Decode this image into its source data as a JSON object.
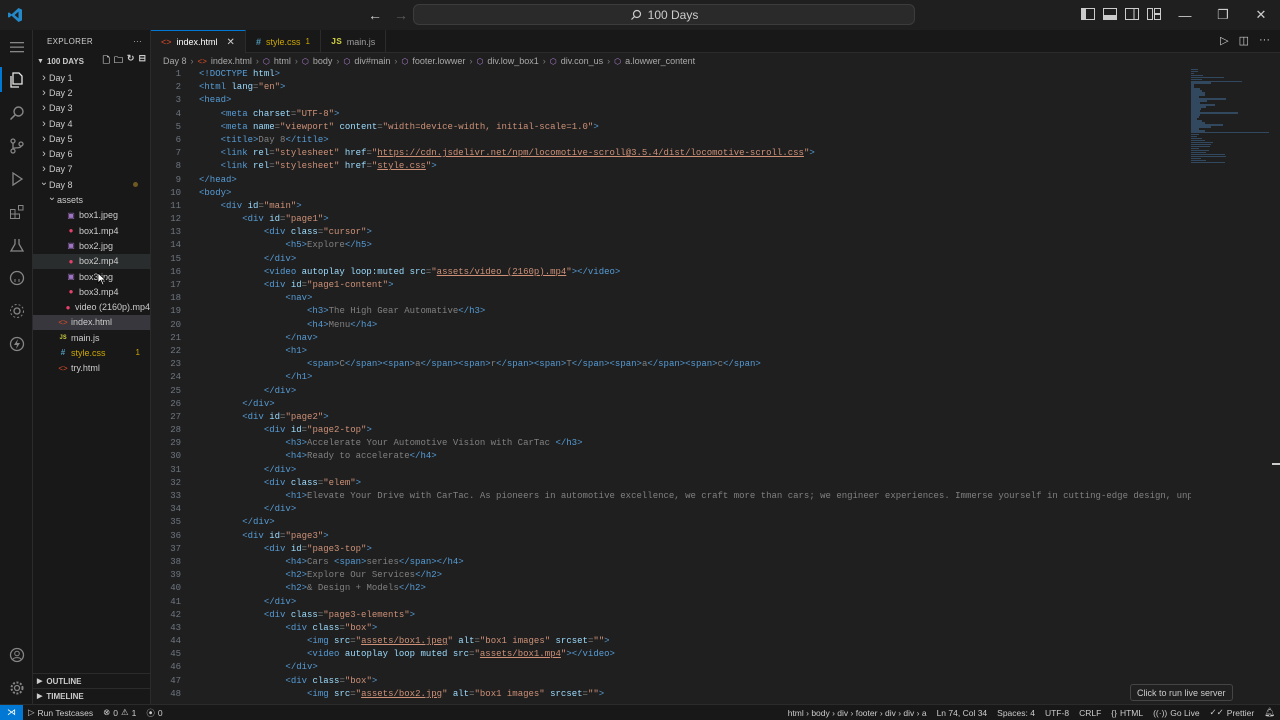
{
  "titlebar": {
    "search_text": "100 Days"
  },
  "explorer": {
    "header": "EXPLORER",
    "root": "100 DAYS",
    "items": [
      {
        "label": "Day 1",
        "kind": "folder",
        "depth": 0
      },
      {
        "label": "Day 2",
        "kind": "folder",
        "depth": 0
      },
      {
        "label": "Day 3",
        "kind": "folder",
        "depth": 0
      },
      {
        "label": "Day 4",
        "kind": "folder",
        "depth": 0
      },
      {
        "label": "Day 5",
        "kind": "folder",
        "depth": 0
      },
      {
        "label": "Day 6",
        "kind": "folder",
        "depth": 0
      },
      {
        "label": "Day 7",
        "kind": "folder",
        "depth": 0
      },
      {
        "label": "Day 8",
        "kind": "folder-open",
        "depth": 0
      },
      {
        "label": "assets",
        "kind": "folder-open",
        "depth": 1
      },
      {
        "label": "box1.jpeg",
        "kind": "img",
        "depth": 2
      },
      {
        "label": "box1.mp4",
        "kind": "mp4",
        "depth": 2
      },
      {
        "label": "box2.jpg",
        "kind": "img",
        "depth": 2
      },
      {
        "label": "box2.mp4",
        "kind": "mp4",
        "depth": 2
      },
      {
        "label": "box3.jpg",
        "kind": "img",
        "depth": 2
      },
      {
        "label": "box3.mp4",
        "kind": "mp4",
        "depth": 2
      },
      {
        "label": "video (2160p).mp4",
        "kind": "mp4",
        "depth": 2
      },
      {
        "label": "index.html",
        "kind": "html",
        "depth": 1
      },
      {
        "label": "main.js",
        "kind": "js",
        "depth": 1
      },
      {
        "label": "style.css",
        "kind": "css",
        "depth": 1,
        "badge": "1"
      },
      {
        "label": "try.html",
        "kind": "html",
        "depth": 1
      }
    ],
    "outline": "OUTLINE",
    "timeline": "TIMELINE"
  },
  "tabs": [
    {
      "label": "index.html",
      "icon": "html",
      "active": true
    },
    {
      "label": "style.css",
      "icon": "css",
      "badge": "1"
    },
    {
      "label": "main.js",
      "icon": "js"
    }
  ],
  "breadcrumb": [
    "Day 8",
    "index.html",
    "html",
    "body",
    "div#main",
    "footer.lowwer",
    "div.low_box1",
    "div.con_us",
    "a.lowwer_content"
  ],
  "code_lines": [
    [
      [
        "t",
        "<!DOCTYPE "
      ],
      [
        "a",
        "html"
      ],
      [
        "t",
        ">"
      ]
    ],
    [
      [
        "t",
        "<html "
      ],
      [
        "a",
        "lang"
      ],
      [
        "p",
        "="
      ],
      [
        "s",
        "\"en\""
      ],
      [
        "t",
        ">"
      ]
    ],
    [
      [
        "t",
        "<head>"
      ]
    ],
    [
      [
        "i",
        "    "
      ],
      [
        "t",
        "<meta "
      ],
      [
        "a",
        "charset"
      ],
      [
        "p",
        "="
      ],
      [
        "s",
        "\"UTF-8\""
      ],
      [
        "t",
        ">"
      ]
    ],
    [
      [
        "i",
        "    "
      ],
      [
        "t",
        "<meta "
      ],
      [
        "a",
        "name"
      ],
      [
        "p",
        "="
      ],
      [
        "s",
        "\"viewport\""
      ],
      [
        "a",
        " content"
      ],
      [
        "p",
        "="
      ],
      [
        "s",
        "\"width=device-width, initial-scale=1.0\""
      ],
      [
        "t",
        ">"
      ]
    ],
    [
      [
        "i",
        "    "
      ],
      [
        "t",
        "<title>"
      ],
      [
        "p",
        "Day 8"
      ],
      [
        "t",
        "</title>"
      ]
    ],
    [
      [
        "i",
        "    "
      ],
      [
        "t",
        "<link "
      ],
      [
        "a",
        "rel"
      ],
      [
        "p",
        "="
      ],
      [
        "s",
        "\"stylesheet\""
      ],
      [
        "a",
        " href"
      ],
      [
        "p",
        "="
      ],
      [
        "s",
        "\""
      ],
      [
        "u",
        "https://cdn.jsdelivr.net/npm/locomotive-scroll@3.5.4/dist/locomotive-scroll.css"
      ],
      [
        "s",
        "\""
      ],
      [
        "t",
        ">"
      ]
    ],
    [
      [
        "i",
        "    "
      ],
      [
        "t",
        "<link "
      ],
      [
        "a",
        "rel"
      ],
      [
        "p",
        "="
      ],
      [
        "s",
        "\"stylesheet\""
      ],
      [
        "a",
        " href"
      ],
      [
        "p",
        "="
      ],
      [
        "s",
        "\""
      ],
      [
        "u",
        "style.css"
      ],
      [
        "s",
        "\""
      ],
      [
        "t",
        ">"
      ]
    ],
    [
      [
        "t",
        "</head>"
      ]
    ],
    [
      [
        "t",
        "<body>"
      ]
    ],
    [
      [
        "i",
        "    "
      ],
      [
        "t",
        "<div "
      ],
      [
        "a",
        "id"
      ],
      [
        "p",
        "="
      ],
      [
        "s",
        "\"main\""
      ],
      [
        "t",
        ">"
      ]
    ],
    [
      [
        "i",
        "        "
      ],
      [
        "t",
        "<div "
      ],
      [
        "a",
        "id"
      ],
      [
        "p",
        "="
      ],
      [
        "s",
        "\"page1\""
      ],
      [
        "t",
        ">"
      ]
    ],
    [
      [
        "i",
        "            "
      ],
      [
        "t",
        "<div "
      ],
      [
        "a",
        "class"
      ],
      [
        "p",
        "="
      ],
      [
        "s",
        "\"cursor\""
      ],
      [
        "t",
        ">"
      ]
    ],
    [
      [
        "i",
        "                "
      ],
      [
        "t",
        "<h5>"
      ],
      [
        "p",
        "Explore"
      ],
      [
        "t",
        "</h5>"
      ]
    ],
    [
      [
        "i",
        "            "
      ],
      [
        "t",
        "</div>"
      ]
    ],
    [
      [
        "i",
        "            "
      ],
      [
        "t",
        "<video "
      ],
      [
        "a",
        "autoplay loop:muted src"
      ],
      [
        "p",
        "="
      ],
      [
        "s",
        "\""
      ],
      [
        "u",
        "assets/video (2160p).mp4"
      ],
      [
        "s",
        "\""
      ],
      [
        "t",
        "></video>"
      ]
    ],
    [
      [
        "i",
        "            "
      ],
      [
        "t",
        "<div "
      ],
      [
        "a",
        "id"
      ],
      [
        "p",
        "="
      ],
      [
        "s",
        "\"page1-content\""
      ],
      [
        "t",
        ">"
      ]
    ],
    [
      [
        "i",
        "                "
      ],
      [
        "t",
        "<nav>"
      ]
    ],
    [
      [
        "i",
        "                    "
      ],
      [
        "t",
        "<h3>"
      ],
      [
        "p",
        "The High Gear Automative"
      ],
      [
        "t",
        "</h3>"
      ]
    ],
    [
      [
        "i",
        "                    "
      ],
      [
        "t",
        "<h4>"
      ],
      [
        "p",
        "Menu"
      ],
      [
        "t",
        "</h4>"
      ]
    ],
    [
      [
        "i",
        "                "
      ],
      [
        "t",
        "</nav>"
      ]
    ],
    [
      [
        "i",
        "                "
      ],
      [
        "t",
        "<h1>"
      ]
    ],
    [
      [
        "i",
        "                    "
      ],
      [
        "t",
        "<span>"
      ],
      [
        "p",
        "C"
      ],
      [
        "t",
        "</span><span>"
      ],
      [
        "p",
        "a"
      ],
      [
        "t",
        "</span><span>"
      ],
      [
        "p",
        "r"
      ],
      [
        "t",
        "</span><span>"
      ],
      [
        "p",
        "T"
      ],
      [
        "t",
        "</span><span>"
      ],
      [
        "p",
        "a"
      ],
      [
        "t",
        "</span><span>"
      ],
      [
        "p",
        "c"
      ],
      [
        "t",
        "</span>"
      ]
    ],
    [
      [
        "i",
        "                "
      ],
      [
        "t",
        "</h1>"
      ]
    ],
    [
      [
        "i",
        "            "
      ],
      [
        "t",
        "</div>"
      ]
    ],
    [
      [
        "i",
        "        "
      ],
      [
        "t",
        "</div>"
      ]
    ],
    [
      [
        "i",
        "        "
      ],
      [
        "t",
        "<div "
      ],
      [
        "a",
        "id"
      ],
      [
        "p",
        "="
      ],
      [
        "s",
        "\"page2\""
      ],
      [
        "t",
        ">"
      ]
    ],
    [
      [
        "i",
        "            "
      ],
      [
        "t",
        "<div "
      ],
      [
        "a",
        "id"
      ],
      [
        "p",
        "="
      ],
      [
        "s",
        "\"page2-top\""
      ],
      [
        "t",
        ">"
      ]
    ],
    [
      [
        "i",
        "                "
      ],
      [
        "t",
        "<h3>"
      ],
      [
        "p",
        "Accelerate Your Automotive Vision with CarTac "
      ],
      [
        "t",
        "</h3>"
      ]
    ],
    [
      [
        "i",
        "                "
      ],
      [
        "t",
        "<h4>"
      ],
      [
        "p",
        "Ready to accelerate"
      ],
      [
        "t",
        "</h4>"
      ]
    ],
    [
      [
        "i",
        "            "
      ],
      [
        "t",
        "</div>"
      ]
    ],
    [
      [
        "i",
        "            "
      ],
      [
        "t",
        "<div "
      ],
      [
        "a",
        "class"
      ],
      [
        "p",
        "="
      ],
      [
        "s",
        "\"elem\""
      ],
      [
        "t",
        ">"
      ]
    ],
    [
      [
        "i",
        "                "
      ],
      [
        "t",
        "<h1>"
      ],
      [
        "p",
        "Elevate Your Drive with CarTac. As pioneers in automotive excellence, we craft more than cars; we engineer experiences. Immerse yourself in cutting-edge design, unpar"
      ]
    ],
    [
      [
        "i",
        "            "
      ],
      [
        "t",
        "</div>"
      ]
    ],
    [
      [
        "i",
        "        "
      ],
      [
        "t",
        "</div>"
      ]
    ],
    [
      [
        "i",
        "        "
      ],
      [
        "t",
        "<div "
      ],
      [
        "a",
        "id"
      ],
      [
        "p",
        "="
      ],
      [
        "s",
        "\"page3\""
      ],
      [
        "t",
        ">"
      ]
    ],
    [
      [
        "i",
        "            "
      ],
      [
        "t",
        "<div "
      ],
      [
        "a",
        "id"
      ],
      [
        "p",
        "="
      ],
      [
        "s",
        "\"page3-top\""
      ],
      [
        "t",
        ">"
      ]
    ],
    [
      [
        "i",
        "                "
      ],
      [
        "t",
        "<h4>"
      ],
      [
        "p",
        "Cars "
      ],
      [
        "t",
        "<span>"
      ],
      [
        "p",
        "series"
      ],
      [
        "t",
        "</span></h4>"
      ]
    ],
    [
      [
        "i",
        "                "
      ],
      [
        "t",
        "<h2>"
      ],
      [
        "p",
        "Explore Our Services"
      ],
      [
        "t",
        "</h2>"
      ]
    ],
    [
      [
        "i",
        "                "
      ],
      [
        "t",
        "<h2>"
      ],
      [
        "p",
        "& Design + Models"
      ],
      [
        "t",
        "</h2>"
      ]
    ],
    [
      [
        "i",
        "            "
      ],
      [
        "t",
        "</div>"
      ]
    ],
    [
      [
        "i",
        "            "
      ],
      [
        "t",
        "<div "
      ],
      [
        "a",
        "class"
      ],
      [
        "p",
        "="
      ],
      [
        "s",
        "\"page3-elements\""
      ],
      [
        "t",
        ">"
      ]
    ],
    [
      [
        "i",
        "                "
      ],
      [
        "t",
        "<div "
      ],
      [
        "a",
        "class"
      ],
      [
        "p",
        "="
      ],
      [
        "s",
        "\"box\""
      ],
      [
        "t",
        ">"
      ]
    ],
    [
      [
        "i",
        "                    "
      ],
      [
        "t",
        "<img "
      ],
      [
        "a",
        "src"
      ],
      [
        "p",
        "="
      ],
      [
        "s",
        "\""
      ],
      [
        "u",
        "assets/box1.jpeg"
      ],
      [
        "s",
        "\""
      ],
      [
        "a",
        " alt"
      ],
      [
        "p",
        "="
      ],
      [
        "s",
        "\"box1 images\""
      ],
      [
        "a",
        " srcset"
      ],
      [
        "p",
        "="
      ],
      [
        "s",
        "\"\""
      ],
      [
        "t",
        ">"
      ]
    ],
    [
      [
        "i",
        "                    "
      ],
      [
        "t",
        "<video "
      ],
      [
        "a",
        "autoplay loop muted src"
      ],
      [
        "p",
        "="
      ],
      [
        "s",
        "\""
      ],
      [
        "u",
        "assets/box1.mp4"
      ],
      [
        "s",
        "\""
      ],
      [
        "t",
        "></video>"
      ]
    ],
    [
      [
        "i",
        "                "
      ],
      [
        "t",
        "</div>"
      ]
    ],
    [
      [
        "i",
        "                "
      ],
      [
        "t",
        "<div "
      ],
      [
        "a",
        "class"
      ],
      [
        "p",
        "="
      ],
      [
        "s",
        "\"box\""
      ],
      [
        "t",
        ">"
      ]
    ],
    [
      [
        "i",
        "                    "
      ],
      [
        "t",
        "<img "
      ],
      [
        "a",
        "src"
      ],
      [
        "p",
        "="
      ],
      [
        "s",
        "\""
      ],
      [
        "u",
        "assets/box2.jpg"
      ],
      [
        "s",
        "\""
      ],
      [
        "a",
        " alt"
      ],
      [
        "p",
        "="
      ],
      [
        "s",
        "\"box1 images\""
      ],
      [
        "a",
        " srcset"
      ],
      [
        "p",
        "="
      ],
      [
        "s",
        "\"\""
      ],
      [
        "t",
        ">"
      ]
    ]
  ],
  "tooltip": "Click to run live server",
  "statusbar": {
    "run_tests": "Run Testcases",
    "errors": "0",
    "warnings": "1",
    "ports": "0",
    "path": "html › body › div › footer › div › div › a",
    "position": "Ln 74, Col 34",
    "spaces": "Spaces: 4",
    "encoding": "UTF-8",
    "eol": "CRLF",
    "language": "HTML",
    "golive": "Go Live",
    "prettier": "Prettier"
  },
  "colors": {
    "accent": "#0078d4",
    "tag": "#569cd6",
    "attr": "#9cdcfe",
    "string": "#ce9178"
  }
}
